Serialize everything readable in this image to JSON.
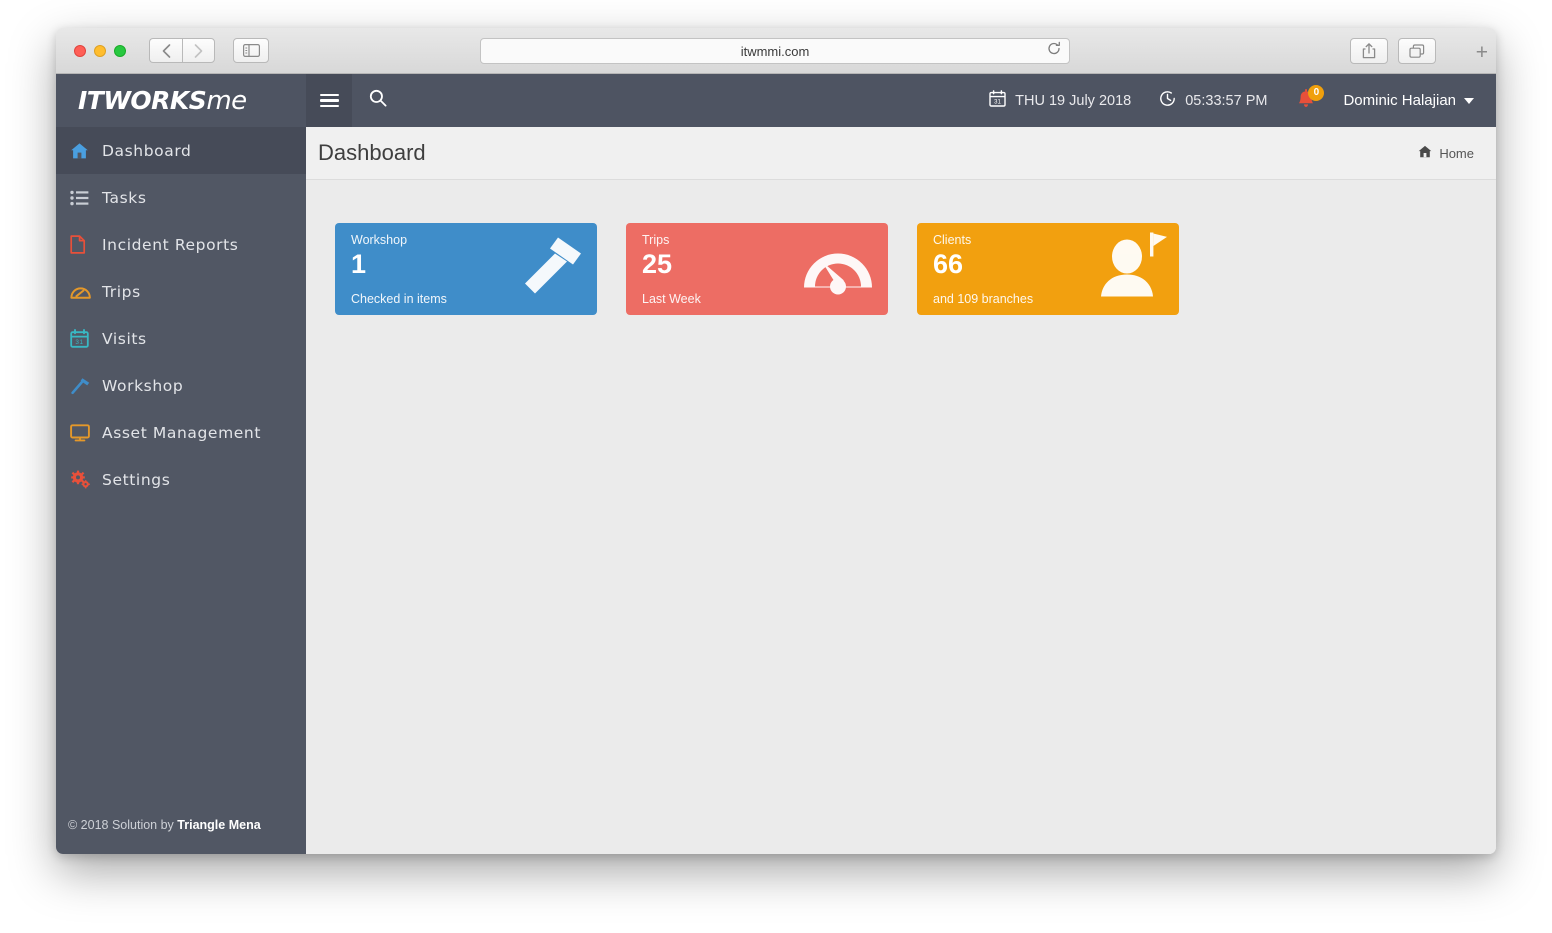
{
  "browser": {
    "url": "itwmmi.com",
    "back_icon": "chevron-left-icon",
    "forward_icon": "chevron-right-icon",
    "sidebar_icon": "sidebar-toggle-icon",
    "reload_icon": "reload-icon",
    "share_icon": "share-icon",
    "tabs_icon": "tabs-overview-icon",
    "newtab_label": "+"
  },
  "topbar": {
    "logo": "ITWORKS",
    "logo_script": "me",
    "menu_icon": "hamburger-menu-icon",
    "search_icon": "search-icon",
    "date": "THU 19 July 2018",
    "time": "05:33:57 PM",
    "calendar_icon": "calendar-icon",
    "clock_icon": "clock-icon",
    "bell_icon": "notification-bell-icon",
    "notification_count": "0",
    "user_name": "Dominic Halajian"
  },
  "sidebar": {
    "items": [
      {
        "label": "Dashboard",
        "icon": "home-icon",
        "active": true
      },
      {
        "label": "Tasks",
        "icon": "list-icon",
        "active": false
      },
      {
        "label": "Incident Reports",
        "icon": "file-icon",
        "active": false
      },
      {
        "label": "Trips",
        "icon": "gauge-icon",
        "active": false
      },
      {
        "label": "Visits",
        "icon": "calendar-icon",
        "active": false
      },
      {
        "label": "Workshop",
        "icon": "hammer-icon",
        "active": false
      },
      {
        "label": "Asset Management",
        "icon": "monitor-icon",
        "active": false
      },
      {
        "label": "Settings",
        "icon": "gears-icon",
        "active": false
      }
    ],
    "footer_copyright": "© 2018 Solution by ",
    "footer_company": "Triangle Mena"
  },
  "page": {
    "title": "Dashboard",
    "breadcrumb_icon": "home-icon",
    "breadcrumb_label": "Home"
  },
  "cards": [
    {
      "title": "Workshop",
      "value": "1",
      "subtitle": "Checked in items",
      "color": "#3f8dc9",
      "theme": "blue",
      "icon": "hammer-icon"
    },
    {
      "title": "Trips",
      "value": "25",
      "subtitle": "Last Week",
      "color": "#ed6d64",
      "theme": "red",
      "icon": "speedometer-icon"
    },
    {
      "title": "Clients",
      "value": "66",
      "subtitle": "and 109 branches",
      "color": "#f2a00f",
      "theme": "orange",
      "icon": "user-flag-icon"
    }
  ]
}
